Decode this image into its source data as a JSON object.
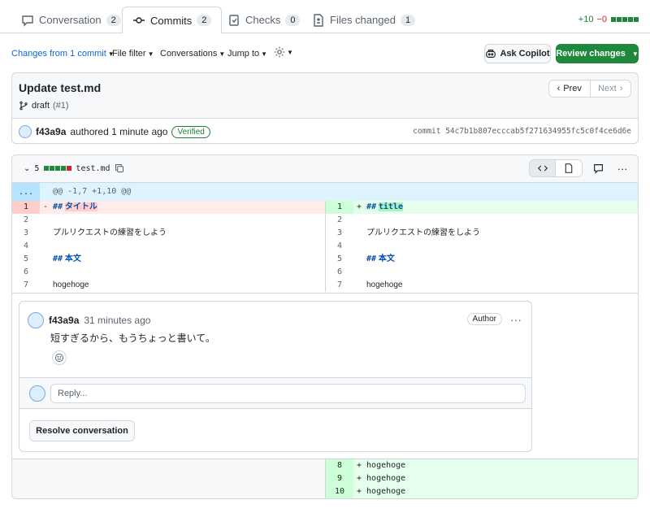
{
  "tabs": [
    {
      "label": "Conversation",
      "count": "2"
    },
    {
      "label": "Commits",
      "count": "2"
    },
    {
      "label": "Checks",
      "count": "0"
    },
    {
      "label": "Files changed",
      "count": "1"
    }
  ],
  "diffstat": {
    "additions": "+10",
    "deletions": "−0"
  },
  "toolbar": {
    "changes_prefix": "Changes from ",
    "changes_link": "1 commit",
    "file_filter": "File filter",
    "conversations": "Conversations",
    "jump_to": "Jump to",
    "copilot": "Ask Copilot",
    "review": "Review changes"
  },
  "commit": {
    "title": "Update test.md",
    "branch": "draft",
    "pr": "(#1)",
    "prev": "Prev",
    "next": "Next",
    "author": "f43a9a",
    "authored": "authored 1 minute ago",
    "verified": "Verified",
    "sha": "commit 54c7b1b807ecccab5f271634955fc5c0f4ce6d6e"
  },
  "file": {
    "changes": "5",
    "name": "test.md",
    "hunk_dots": "...",
    "hunk": "@@ -1,7 +1,10 @@"
  },
  "lines": {
    "l1": {
      "num": "1",
      "sign": "- ",
      "hash": "##",
      "text": "タイトル"
    },
    "r1": {
      "num": "1",
      "sign": "+ ",
      "hash": "##",
      "text": "title"
    },
    "n2": "2",
    "n3": "3",
    "t3": "プルリクエストの練習をしよう",
    "n4": "4",
    "n5": "5",
    "hash5": "##",
    "t5": "本文",
    "n6": "6",
    "n7": "7",
    "t7": "hogehoge",
    "add": [
      {
        "num": "8",
        "text": "+ hogehoge"
      },
      {
        "num": "9",
        "text": "+ hogehoge"
      },
      {
        "num": "10",
        "text": "+ hogehoge"
      }
    ]
  },
  "comment": {
    "author": "f43a9a",
    "time": "31 minutes ago",
    "badge": "Author",
    "more": "···",
    "body": "短すぎるから、もうちょっと書いて。",
    "reply_placeholder": "Reply...",
    "resolve": "Resolve conversation"
  }
}
